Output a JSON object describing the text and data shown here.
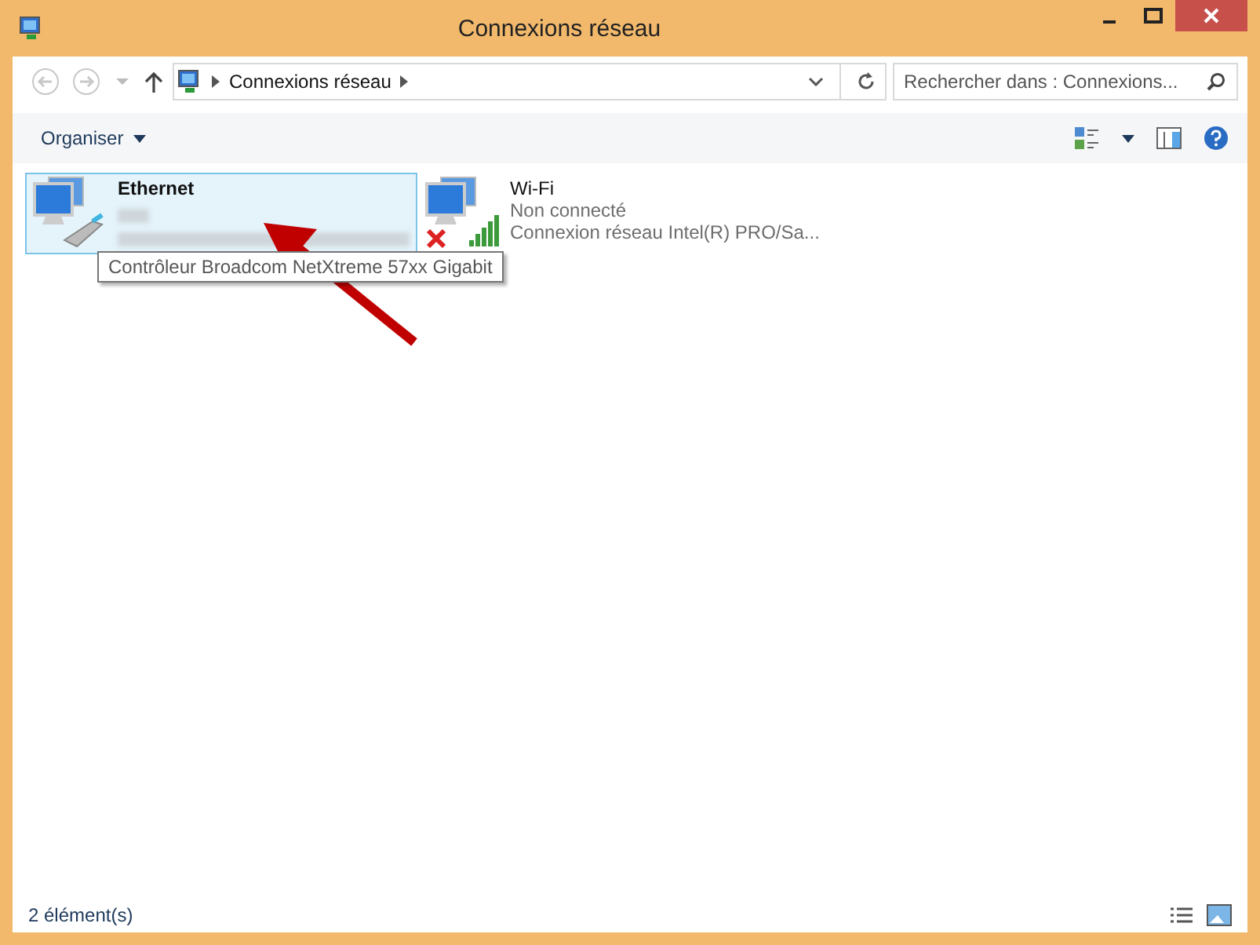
{
  "window": {
    "title": "Connexions réseau"
  },
  "address_bar": {
    "path": [
      "Connexions réseau"
    ]
  },
  "search": {
    "placeholder": "Rechercher dans : Connexions..."
  },
  "command_bar": {
    "items": [
      "Organiser"
    ]
  },
  "connections": [
    {
      "kind": "wired",
      "name": "Ethernet",
      "selected": true,
      "disconnected": false
    },
    {
      "kind": "wireless",
      "name": "Wi-Fi",
      "selected": false,
      "disconnected": true,
      "status": "Non connecté",
      "device": "Connexion réseau Intel(R) PRO/Sa..."
    }
  ],
  "tooltip": {
    "text": "Contrôleur Broadcom NetXtreme 57xx Gigabit"
  },
  "status_bar": {
    "count": "2 élément(s)"
  }
}
